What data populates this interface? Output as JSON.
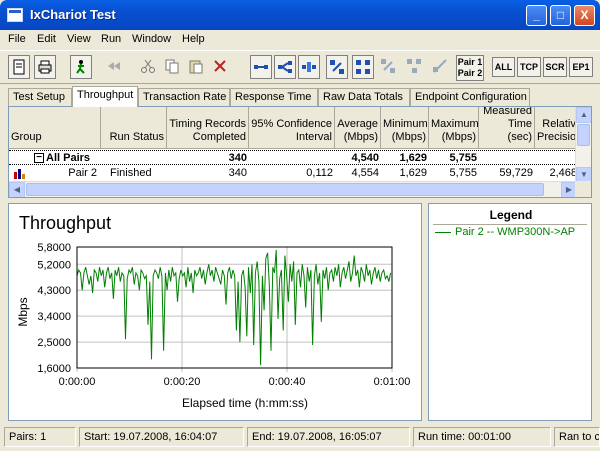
{
  "window": {
    "title": "IxChariot Test",
    "controls": [
      "_",
      "□",
      "X"
    ]
  },
  "menu": [
    "File",
    "Edit",
    "View",
    "Run",
    "Window",
    "Help"
  ],
  "toolbar": {
    "pair_label_1": "Pair 1",
    "pair_label_2": "Pair 2",
    "text_buttons": [
      "ALL",
      "TCP",
      "SCR",
      "EP1"
    ]
  },
  "tabs": [
    "Test Setup",
    "Throughput",
    "Transaction Rate",
    "Response Time",
    "Raw Data Totals",
    "Endpoint Configuration"
  ],
  "active_tab": "Throughput",
  "grid": {
    "headers": {
      "group": "Group",
      "run_status": "Run Status",
      "timing_records": "Timing Records Completed",
      "confidence": "95% Confidence Interval",
      "average": "Average (Mbps)",
      "minimum": "Minimum (Mbps)",
      "maximum": "Maximum (Mbps)",
      "measured_time": "Measured Time (sec)",
      "relative_precision": "Relative Precision"
    },
    "all_pairs": {
      "expander": "−",
      "group": "All Pairs",
      "timing_records": "340",
      "average": "4,540",
      "minimum": "1,629",
      "maximum": "5,755"
    },
    "pair2": {
      "group": "Pair 2",
      "run_status": "Finished",
      "timing_records": "340",
      "confidence": "0,112",
      "average": "4,554",
      "minimum": "1,629",
      "maximum": "5,755",
      "measured_time": "59,729",
      "relative_precision": "2,468"
    }
  },
  "chart_data": {
    "type": "line",
    "title": "Throughput",
    "xlabel": "Elapsed time (h:mm:ss)",
    "ylabel": "Mbps",
    "ylim": [
      1.6,
      5.8
    ],
    "xlim_seconds": [
      0,
      60
    ],
    "y_ticks": [
      "5,8000",
      "5,2000",
      "4,3000",
      "3,4000",
      "2,5000",
      "1,6000"
    ],
    "y_tick_values": [
      5.8,
      5.2,
      4.3,
      3.4,
      2.5,
      1.6
    ],
    "x_ticks": [
      "0:00:00",
      "0:00:20",
      "0:00:40",
      "0:01:00"
    ],
    "line_color": "#008000",
    "grid": true,
    "legend": {
      "title": "Legend",
      "position": "right",
      "items": [
        "Pair 2 -- WMP300N->AP"
      ]
    },
    "series": [
      {
        "name": "Pair 2 -- WMP300N->AP",
        "x": [
          0.0,
          0.33,
          0.66,
          0.99,
          1.32,
          1.65,
          1.98,
          2.31,
          2.64,
          2.97,
          3.3,
          3.63,
          3.96,
          4.29,
          4.62,
          4.95,
          5.28,
          5.61,
          5.94,
          6.27,
          6.6,
          6.93,
          7.26,
          7.59,
          7.92,
          8.25,
          8.58,
          8.91,
          9.24,
          9.57,
          9.9,
          10.23,
          10.56,
          10.89,
          11.22,
          11.55,
          11.88,
          12.21,
          12.54,
          12.87,
          13.2,
          13.53,
          13.86,
          14.19,
          14.52,
          14.85,
          15.18,
          15.51,
          15.84,
          16.17,
          16.5,
          16.83,
          17.16,
          17.49,
          17.82,
          18.15,
          18.48,
          18.81,
          19.14,
          19.47,
          19.8,
          20.13,
          20.46,
          20.79,
          21.12,
          21.45,
          21.78,
          22.11,
          22.44,
          22.77,
          23.1,
          23.43,
          23.76,
          24.09,
          24.42,
          24.75,
          25.08,
          25.41,
          25.74,
          26.07,
          26.4,
          26.73,
          27.06,
          27.39,
          27.72,
          28.05,
          28.38,
          28.71,
          29.04,
          29.37,
          29.7,
          30.03,
          30.36,
          30.69,
          31.02,
          31.35,
          31.68,
          32.01,
          32.34,
          32.67,
          33.0,
          33.33,
          33.66,
          33.99,
          34.32,
          34.65,
          34.98,
          35.31,
          35.64,
          35.97,
          36.3,
          36.63,
          36.96,
          37.29,
          37.62,
          37.95,
          38.28,
          38.61,
          38.94,
          39.27,
          39.6,
          39.93,
          40.26,
          40.59,
          40.92,
          41.25,
          41.58,
          41.91,
          42.24,
          42.57,
          42.9,
          43.23,
          43.56,
          43.89,
          44.22,
          44.55,
          44.88,
          45.21,
          45.54,
          45.87,
          46.2,
          46.53,
          46.86,
          47.19,
          47.52,
          47.85,
          48.18,
          48.51,
          48.84,
          49.17,
          49.5,
          49.83,
          50.16,
          50.49,
          50.82,
          51.15,
          51.48,
          51.81,
          52.14,
          52.47,
          52.8,
          53.13,
          53.46,
          53.79,
          54.12,
          54.45,
          54.78,
          55.11,
          55.44,
          55.77,
          56.1,
          56.43,
          56.76,
          57.09,
          57.42,
          57.75,
          58.08,
          58.41,
          58.74,
          59.07,
          59.4,
          59.73
        ],
        "values": [
          4.8,
          5.0,
          4.9,
          4.3,
          4.9,
          5.1,
          4.8,
          4.5,
          4.8,
          4.2,
          5.0,
          4.9,
          4.6,
          5.1,
          4.8,
          5.0,
          4.4,
          4.9,
          5.1,
          4.7,
          4.9,
          4.0,
          5.0,
          4.8,
          5.1,
          4.6,
          4.9,
          4.8,
          2.6,
          4.7,
          5.0,
          4.9,
          5.1,
          4.5,
          4.9,
          4.8,
          4.3,
          5.0,
          4.9,
          4.7,
          4.8,
          3.1,
          4.6,
          1.9,
          4.8,
          5.0,
          4.9,
          4.7,
          5.1,
          4.8,
          2.2,
          4.9,
          4.3,
          5.0,
          4.6,
          5.1,
          4.8,
          4.9,
          3.9,
          4.7,
          5.0,
          4.8,
          4.9,
          4.4,
          5.1,
          4.6,
          4.9,
          4.2,
          5.0,
          4.8,
          4.9,
          5.1,
          4.7,
          5.0,
          4.5,
          4.9,
          5.2,
          4.8,
          5.0,
          4.6,
          5.1,
          4.9,
          4.7,
          4.5,
          5.0,
          4.8,
          3.8,
          4.9,
          5.1,
          4.7,
          5.0,
          4.8,
          2.9,
          4.6,
          2.5,
          4.8,
          5.0,
          4.4,
          2.7,
          5.1,
          4.2,
          5.2,
          2.4,
          4.9,
          5.3,
          4.6,
          1.7,
          4.8,
          3.6,
          5.4,
          5.6,
          4.5,
          2.2,
          5.1,
          4.9,
          5.7,
          3.3,
          4.7,
          5.0,
          2.9,
          5.5,
          4.8,
          3.9,
          5.2,
          4.6,
          5.3,
          3.1,
          4.9,
          5.0,
          4.4,
          5.2,
          4.8,
          3.7,
          5.1,
          4.6,
          5.0,
          2.4,
          4.8,
          5.2,
          4.5,
          4.9,
          3.2,
          5.0,
          4.7,
          5.1,
          4.3,
          4.9,
          5.0,
          4.6,
          5.1,
          4.8,
          5.2,
          4.4,
          4.9,
          5.1,
          4.7,
          5.0,
          5.3,
          4.6,
          4.9,
          5.5,
          4.8,
          5.0,
          4.4,
          5.1,
          4.9,
          4.6,
          5.2,
          4.8,
          5.0,
          4.5,
          4.9,
          5.1,
          4.7,
          5.0,
          4.6,
          4.9,
          5.0,
          4.7,
          4.8,
          4.6,
          4.9
        ]
      }
    ]
  },
  "status": {
    "pairs": "Pairs: 1",
    "start": "Start: 19.07.2008, 16:04:07",
    "end": "End: 19.07.2008, 16:05:07",
    "run_time": "Run time: 00:01:00",
    "ran_to": "Ran to c"
  }
}
